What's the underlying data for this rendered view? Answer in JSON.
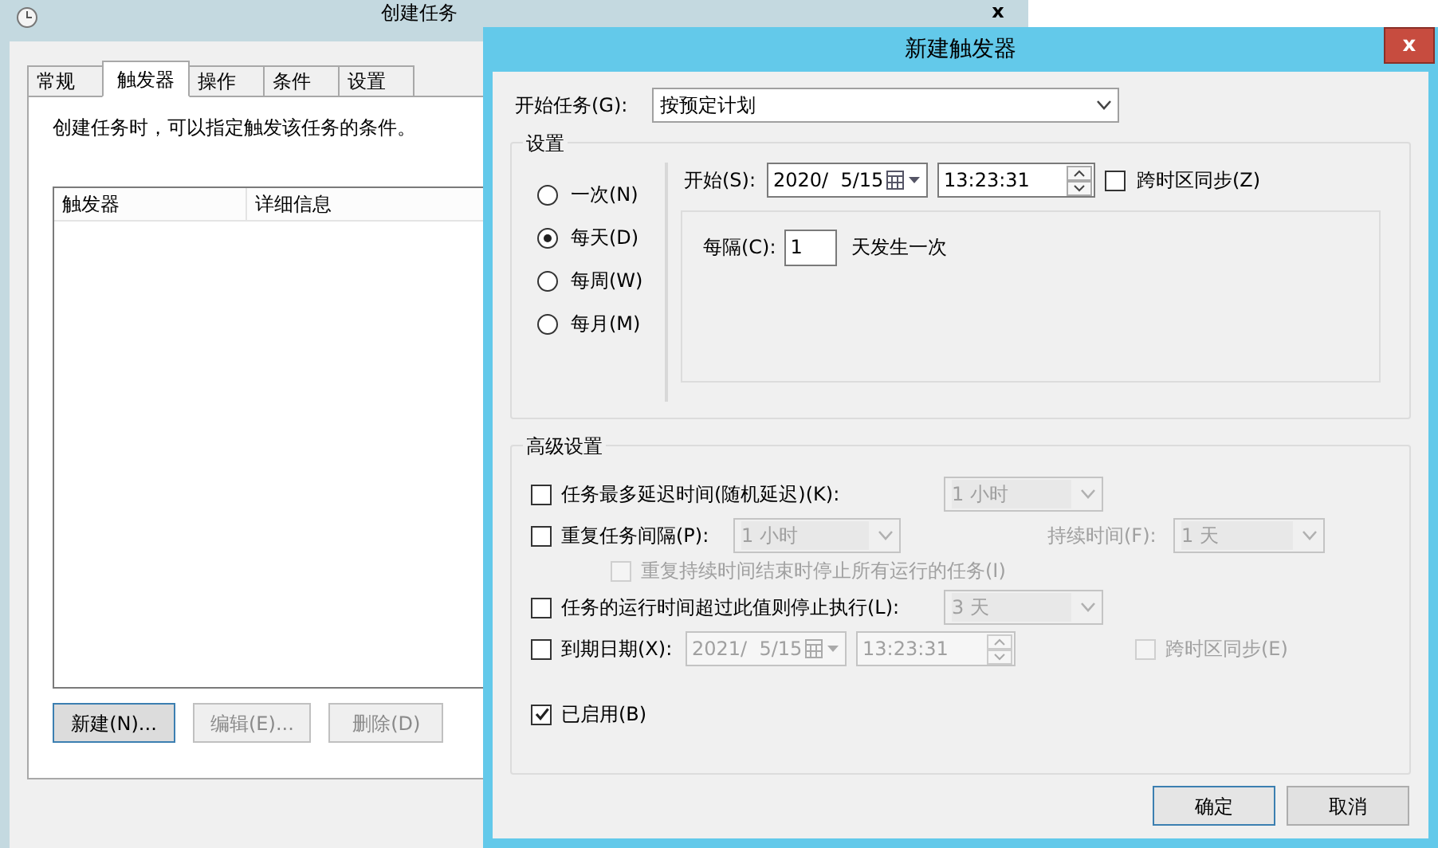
{
  "background_window": {
    "title": "创建任务",
    "close": "x",
    "tabs": [
      {
        "label": "常规",
        "selected": false
      },
      {
        "label": "触发器",
        "selected": true
      },
      {
        "label": "操作",
        "selected": false
      },
      {
        "label": "条件",
        "selected": false
      },
      {
        "label": "设置",
        "selected": false
      }
    ],
    "description": "创建任务时，可以指定触发该任务的条件。",
    "table": {
      "columns": [
        "触发器",
        "详细信息"
      ]
    },
    "buttons": [
      {
        "label": "新建(N)...",
        "disabled": false
      },
      {
        "label": "编辑(E)...",
        "disabled": true
      },
      {
        "label": "删除(D)",
        "disabled": true
      }
    ]
  },
  "dialog": {
    "title": "新建触发器",
    "close": "x",
    "begin_label": "开始任务(G):",
    "begin_value": "按预定计划",
    "settings": {
      "title": "设置",
      "schedule": [
        {
          "label": "一次(N)",
          "selected": false
        },
        {
          "label": "每天(D)",
          "selected": true
        },
        {
          "label": "每周(W)",
          "selected": false
        },
        {
          "label": "每月(M)",
          "selected": false
        }
      ],
      "start_label": "开始(S):",
      "start_date": "2020/  5/15",
      "start_time": "13:23:31",
      "sync": {
        "label": "跨时区同步(Z)",
        "checked": false
      },
      "interval_label": "每隔(C):",
      "interval_value": "1",
      "interval_suffix": "天发生一次"
    },
    "advanced": {
      "title": "高级设置",
      "delay": {
        "label": "任务最多延迟时间(随机延迟)(K):",
        "checked": false,
        "value": "1 小时",
        "disabled": true
      },
      "repeat": {
        "label": "重复任务间隔(P):",
        "checked": false,
        "value": "1 小时",
        "disabled": true,
        "duration_label": "持续时间(F):",
        "duration_value": "1 天"
      },
      "stop_all": {
        "label": "重复持续时间结束时停止所有运行的任务(I)",
        "checked": false,
        "disabled": true
      },
      "stop_after": {
        "label": "任务的运行时间超过此值则停止执行(L):",
        "checked": false,
        "value": "3 天",
        "disabled": true
      },
      "expire": {
        "label": "到期日期(X):",
        "checked": false,
        "date": "2021/  5/15",
        "time": "13:23:31",
        "disabled": true
      },
      "expire_sync": {
        "label": "跨时区同步(E)",
        "checked": false,
        "disabled": true
      },
      "enabled": {
        "label": "已启用(B)",
        "checked": true
      }
    },
    "buttons": [
      "确定",
      "取消"
    ]
  }
}
